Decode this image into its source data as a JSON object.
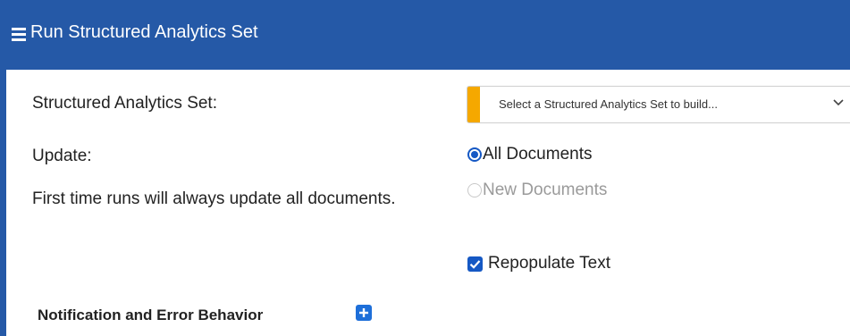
{
  "header": {
    "title": "Run Structured Analytics Set",
    "menu_icon": "hamburger-menu-icon"
  },
  "form": {
    "set_label": "Structured Analytics Set:",
    "set_select": {
      "value": "Select a Structured Analytics Set to build...",
      "accent_color": "#f5a800"
    },
    "update_label": "Update:",
    "update_note": "First time runs will always update all documents.",
    "update_options": [
      {
        "label": "All Documents",
        "selected": true,
        "enabled": true
      },
      {
        "label": "New Documents",
        "selected": false,
        "enabled": false
      }
    ],
    "repopulate": {
      "label": "Repopulate Text",
      "checked": true
    }
  },
  "section": {
    "title": "Notification and Error Behavior",
    "expand_icon": "plus-icon"
  },
  "colors": {
    "header_bg": "#2559a7",
    "accent_blue": "#1558c4"
  }
}
